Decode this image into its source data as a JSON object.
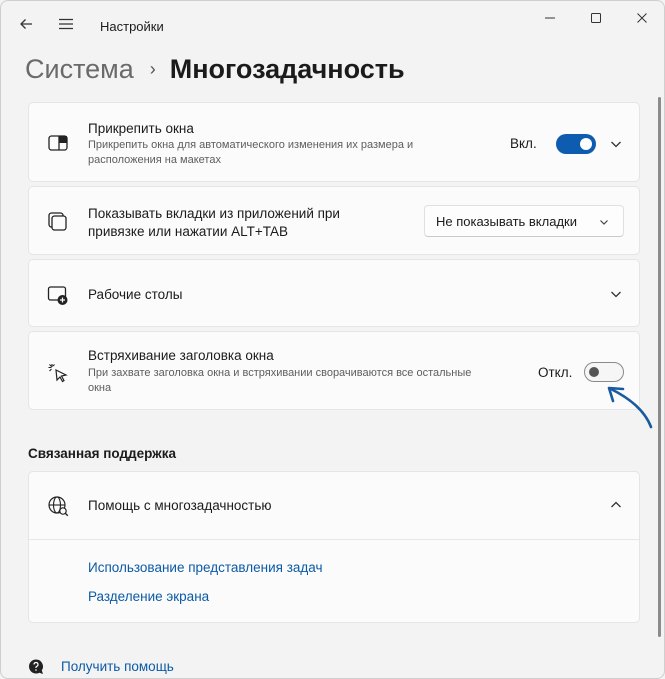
{
  "window": {
    "app_title": "Настройки"
  },
  "breadcrumb": {
    "parent": "Система",
    "separator": "›",
    "current": "Многозадачность"
  },
  "settings": {
    "snap": {
      "title": "Прикрепить окна",
      "description_line1": "Прикрепить окна для автоматического изменения их размера и",
      "description_line2": "расположения на макетах",
      "toggle_label": "Вкл.",
      "toggle_on": true,
      "icon": "snap-layout-icon"
    },
    "alt_tab": {
      "title_line1": "Показывать вкладки из приложений при",
      "title_line2": "привязке или нажатии ALT+TAB",
      "dropdown_value": "Не показывать вкладки",
      "icon": "window-stack-icon"
    },
    "desktops": {
      "title": "Рабочие столы",
      "icon": "virtual-desktop-add-icon"
    },
    "shake": {
      "title": "Встряхивание заголовка окна",
      "description_line1": "При захвате заголовка окна и встряхивании сворачиваются все остальные",
      "description_line2": "окна",
      "toggle_label": "Откл.",
      "toggle_on": false,
      "icon": "shake-cursor-icon"
    }
  },
  "related_support": {
    "section_title": "Связанная поддержка",
    "help_title": "Помощь с многозадачностью",
    "links": [
      "Использование представления задач",
      "Разделение экрана"
    ]
  },
  "footer": {
    "get_help": "Получить помощь"
  },
  "colors": {
    "accent": "#0e5cb0",
    "link": "#0b5aa6",
    "annotation_arrow": "#1a5aa0"
  }
}
